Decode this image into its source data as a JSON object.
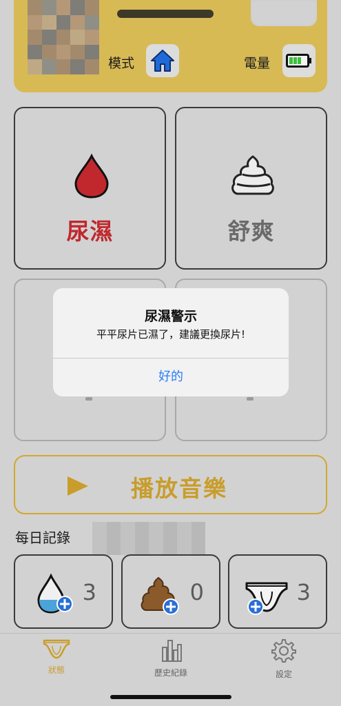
{
  "header": {
    "mode_label": "模式",
    "battery_label": "電量",
    "mode_icon": "house-icon",
    "battery_icon": "battery-icon"
  },
  "status": {
    "wet_label": "尿濕",
    "comfortable_label": "舒爽"
  },
  "music": {
    "play_label": "播放音樂"
  },
  "records": {
    "title": "每日記錄",
    "pee_count": "3",
    "poop_count": "0",
    "diaper_count": "3"
  },
  "alert": {
    "title": "尿濕警示",
    "message": "平平尿片已濕了，建議更換尿片!",
    "ok_label": "好的"
  },
  "tabs": [
    {
      "label": "狀態",
      "icon": "diaper-icon"
    },
    {
      "label": "歷史紀錄",
      "icon": "bar-chart-icon"
    },
    {
      "label": "設定",
      "icon": "gear-icon"
    }
  ],
  "colors": {
    "header_bg": "#d8ba55",
    "wet_red": "#c0282d",
    "accent_gold": "#c99d2b",
    "link_blue": "#2b7cf6"
  }
}
